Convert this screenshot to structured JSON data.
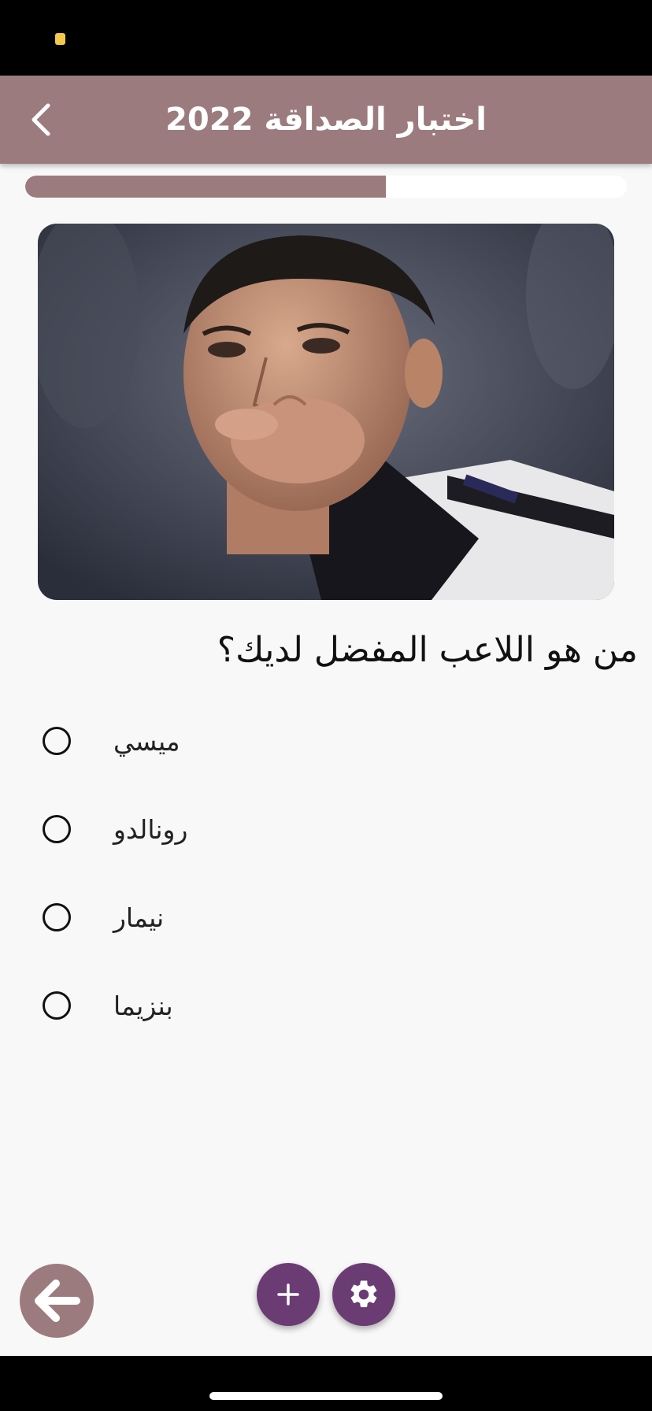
{
  "app_bar": {
    "title": "اختبار الصداقة 2022",
    "back_icon": "chevron-left-icon"
  },
  "progress": {
    "fraction": 0.6
  },
  "question": {
    "image_description": "player-photo",
    "text": "من هو اللاعب المفضل لديك؟"
  },
  "options": [
    {
      "label": "ميسي",
      "selected": false
    },
    {
      "label": "رونالدو",
      "selected": false
    },
    {
      "label": "نيمار",
      "selected": false
    },
    {
      "label": "بنزيما",
      "selected": false
    }
  ],
  "bottom_actions": {
    "back_icon": "arrow-left-icon",
    "add_icon": "plus-icon",
    "settings_icon": "gear-icon"
  },
  "colors": {
    "accent": "#9c7b7e",
    "fab": "#6a3c73"
  }
}
